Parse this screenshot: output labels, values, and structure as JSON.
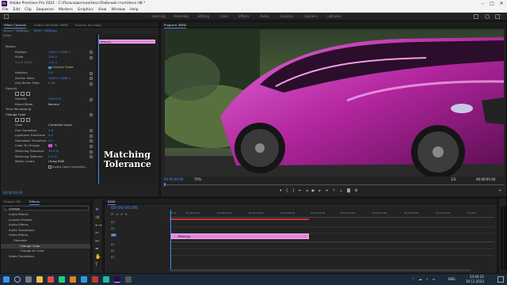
{
  "app": {
    "title": "Adobe Premiere Pro 2021 - C:\\Пользователи\\Несс\\Рабочий стол\\Ненз Н8 *",
    "logo": "Pr"
  },
  "window_controls": [
    "–",
    "□",
    "✕"
  ],
  "menu": [
    "File",
    "Edit",
    "Clip",
    "Sequence",
    "Markers",
    "Graphics",
    "View",
    "Window",
    "Help"
  ],
  "workspaces": [
    "Learning",
    "Assembly",
    "Editing",
    "Color",
    "Effects",
    "Audio",
    "Graphics",
    "Captions",
    "Libraries"
  ],
  "effect_controls": {
    "tabs": [
      "Effect Controls",
      "Audio Clip Mixer: BMW",
      "Source: (no clips)"
    ],
    "source_label": "Source * BMW.jpg",
    "sequence_label": "BMW * BMW.jpg",
    "section_video": "Video",
    "rows": [
      {
        "label": "Motion",
        "value": ""
      },
      {
        "label": "Position",
        "value": "1920.0    1080.0"
      },
      {
        "label": "Scale",
        "value": "100.0"
      },
      {
        "label": "Scale Width",
        "value": "100.0"
      },
      {
        "label": "",
        "value": "Uniform Scale"
      },
      {
        "label": "Rotation",
        "value": "0.0"
      },
      {
        "label": "Anchor Point",
        "value": "1920.0    1080.0"
      },
      {
        "label": "Anti-flicker Filter",
        "value": "0.00"
      },
      {
        "label": "Opacity",
        "value": ""
      },
      {
        "label": "",
        "value": ""
      },
      {
        "label": "Opacity",
        "value": "100.0 %"
      },
      {
        "label": "Blend Mode",
        "value": "Normal"
      },
      {
        "label": "Time Remapping",
        "value": ""
      },
      {
        "label": "Change Color",
        "value": ""
      },
      {
        "label": "",
        "value": ""
      },
      {
        "label": "View",
        "value": "Corrected Layer"
      },
      {
        "label": "Hue Transform",
        "value": "0.0"
      },
      {
        "label": "Lightness Transform",
        "value": "0.0"
      },
      {
        "label": "Saturation Transform",
        "value": "0.0"
      },
      {
        "label": "Color To Change",
        "value": ""
      },
      {
        "label": "Matching Tolerance",
        "value": "15.0 %"
      },
      {
        "label": "Matching Softness",
        "value": "0.0 %"
      },
      {
        "label": "Match Colors",
        "value": "Using RGB"
      },
      {
        "label": "",
        "value": "Invert Color Correctio..."
      }
    ],
    "clip_name": "BMW.jpg",
    "timecode": "00:00:00:00"
  },
  "overlay": {
    "line1": "Matching",
    "line2": "Tolerance"
  },
  "program": {
    "tab": "Program: BMW",
    "timecode_left": "00:00:00:00",
    "zoom": "75%",
    "fraction": "1/2",
    "timecode_right": "00:00:05:00"
  },
  "project": {
    "tabs": [
      "Project: Н8",
      "Effects"
    ],
    "search": "change",
    "tree": [
      "Audio Effects",
      "Lumetri Presets",
      "Audio Effects",
      "Audio Transitions",
      "Video Effects",
      "Obsolete",
      "Change Color",
      "Change to Color",
      "Video Transitions"
    ]
  },
  "timeline": {
    "tab": "BMW",
    "timecode": "00:00:00:00",
    "ruler": [
      "00:00",
      "00:00:01:00",
      "00:00:02:00",
      "00:00:03:00",
      "00:00:04:00",
      "00:00:05:00",
      "00:00:06:00",
      "00:00:07:00",
      "00:00:08:00",
      "00:00:09:00",
      "00:00:1"
    ],
    "tracks": [
      "V3",
      "V2",
      "V1",
      "A1",
      "A2",
      "A3"
    ],
    "clip": "BMW.jpg"
  },
  "taskbar": {
    "weather": "",
    "lang": "ENG",
    "time": "23:44:22",
    "date": "30.11.2023"
  },
  "colors": {
    "accent": "#3f8ef5",
    "clip": "#e283e0",
    "playhead": "#3f8ef5"
  }
}
